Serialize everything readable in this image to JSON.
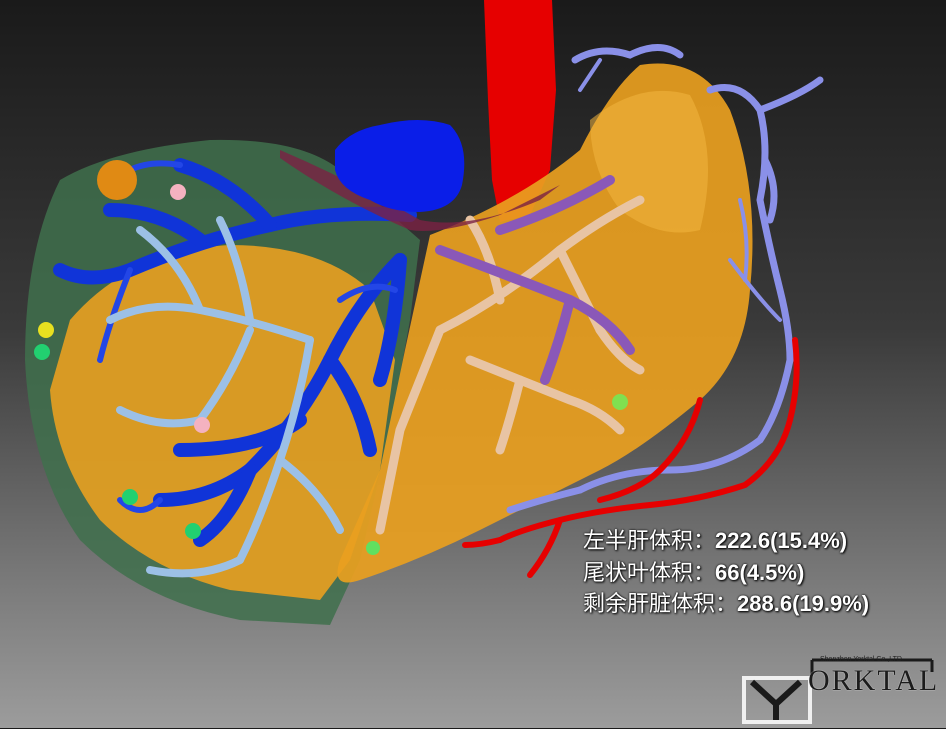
{
  "volumes": [
    {
      "label": "左半肝体积：",
      "value": "222.6(15.4%)"
    },
    {
      "label": "尾状叶体积：",
      "value": "66(4.5%)"
    },
    {
      "label": "剩余肝脏体积：",
      "value": "288.6(19.9%)"
    }
  ],
  "logo": {
    "company_line": "Shenzhen Yorktal Co.,LTD.",
    "initial": "Y",
    "wordmark": "ORKTAL"
  },
  "colors": {
    "liver": "#e9a020",
    "liver_shell": "#3f6e4c",
    "hepatic_vein": "#1034d8",
    "portal_vein": "#9cc0e6",
    "left_portal": "#e8c4a4",
    "left_vein": "#8a58b8",
    "aorta": "#e60000",
    "ivc": "#0a1ee8",
    "outer_vessels": "#8a90e8"
  }
}
